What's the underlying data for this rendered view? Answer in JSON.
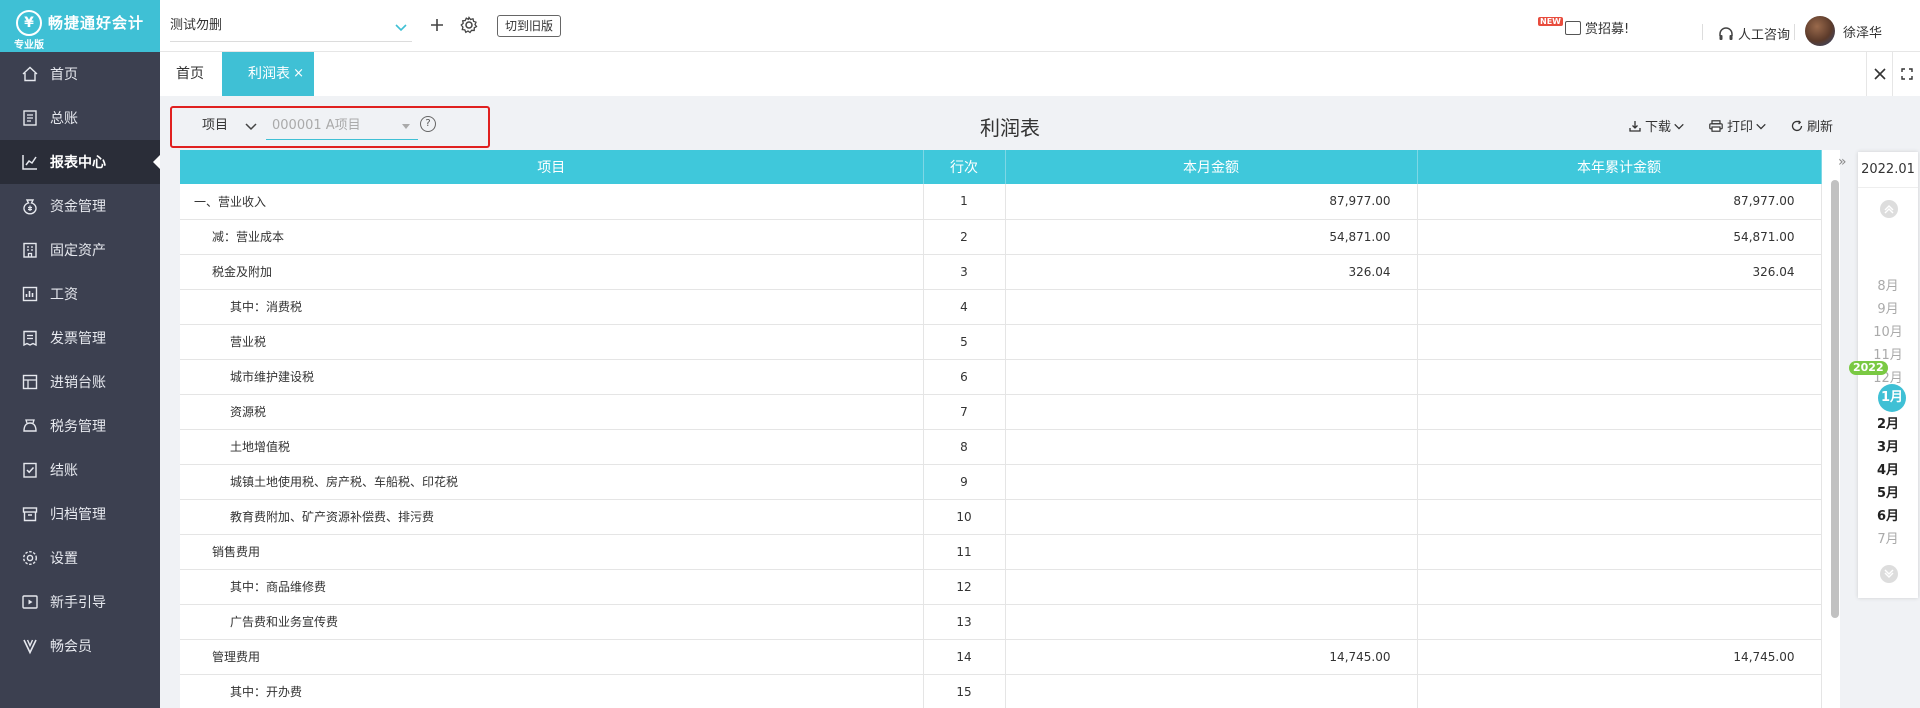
{
  "app": {
    "brand": "畅捷通好会计",
    "edition": "专业版"
  },
  "sidebar": {
    "items": [
      {
        "label": "首页",
        "icon": "home-icon"
      },
      {
        "label": "总账",
        "icon": "ledger-icon"
      },
      {
        "label": "报表中心",
        "icon": "chart-icon",
        "active": true
      },
      {
        "label": "资金管理",
        "icon": "money-bag-icon"
      },
      {
        "label": "固定资产",
        "icon": "building-icon"
      },
      {
        "label": "工资",
        "icon": "salary-icon"
      },
      {
        "label": "发票管理",
        "icon": "invoice-icon"
      },
      {
        "label": "进销台账",
        "icon": "inventory-icon"
      },
      {
        "label": "税务管理",
        "icon": "tax-icon"
      },
      {
        "label": "结账",
        "icon": "closing-icon"
      },
      {
        "label": "归档管理",
        "icon": "archive-icon"
      },
      {
        "label": "设置",
        "icon": "gear-icon"
      },
      {
        "label": "新手引导",
        "icon": "guide-icon"
      },
      {
        "label": "畅会员",
        "icon": "vip-icon"
      }
    ]
  },
  "topbar": {
    "account": "测试勿删",
    "switch_old": "切到旧版",
    "promo": "赏招募!",
    "promo_badge": "NEW",
    "support": "人工咨询",
    "user": "徐泽华"
  },
  "tabs": {
    "home": "首页",
    "profit": "利润表",
    "close": "×"
  },
  "toolbar": {
    "dimension": "项目",
    "item_placeholder": "000001 A项目",
    "help": "?",
    "title": "利润表",
    "download": "下载",
    "print": "打印",
    "refresh": "刷新"
  },
  "table": {
    "headers": [
      "项目",
      "行次",
      "本月金额",
      "本年累计金额"
    ],
    "rows": [
      {
        "item": "一、营业收入",
        "line": "1",
        "month": "87,977.00",
        "year": "87,977.00",
        "indent": 0
      },
      {
        "item": "减：营业成本",
        "line": "2",
        "month": "54,871.00",
        "year": "54,871.00",
        "indent": 1
      },
      {
        "item": "税金及附加",
        "line": "3",
        "month": "326.04",
        "year": "326.04",
        "indent": 1
      },
      {
        "item": "其中：消费税",
        "line": "4",
        "month": "",
        "year": "",
        "indent": 2
      },
      {
        "item": "营业税",
        "line": "5",
        "month": "",
        "year": "",
        "indent": 2
      },
      {
        "item": "城市维护建设税",
        "line": "6",
        "month": "",
        "year": "",
        "indent": 2
      },
      {
        "item": "资源税",
        "line": "7",
        "month": "",
        "year": "",
        "indent": 2
      },
      {
        "item": "土地增值税",
        "line": "8",
        "month": "",
        "year": "",
        "indent": 2
      },
      {
        "item": "城镇土地使用税、房产税、车船税、印花税",
        "line": "9",
        "month": "",
        "year": "",
        "indent": 2
      },
      {
        "item": "教育费附加、矿产资源补偿费、排污费",
        "line": "10",
        "month": "",
        "year": "",
        "indent": 2
      },
      {
        "item": "销售费用",
        "line": "11",
        "month": "",
        "year": "",
        "indent": 1
      },
      {
        "item": "其中：商品维修费",
        "line": "12",
        "month": "",
        "year": "",
        "indent": 2
      },
      {
        "item": "广告费和业务宣传费",
        "line": "13",
        "month": "",
        "year": "",
        "indent": 2
      },
      {
        "item": "管理费用",
        "line": "14",
        "month": "14,745.00",
        "year": "14,745.00",
        "indent": 1
      },
      {
        "item": "其中：开办费",
        "line": "15",
        "month": "",
        "year": "",
        "indent": 2
      }
    ]
  },
  "period": {
    "current": "2022.01",
    "year_badge": "2022",
    "months": [
      {
        "label": "8月",
        "style": "gray"
      },
      {
        "label": "9月",
        "style": "gray"
      },
      {
        "label": "10月",
        "style": "gray"
      },
      {
        "label": "11月",
        "style": "gray"
      },
      {
        "label": "12月",
        "style": "gray"
      },
      {
        "label": "1月",
        "style": "active"
      },
      {
        "label": "2月",
        "style": "dark"
      },
      {
        "label": "3月",
        "style": "dark"
      },
      {
        "label": "4月",
        "style": "dark"
      },
      {
        "label": "5月",
        "style": "dark"
      },
      {
        "label": "6月",
        "style": "dark"
      },
      {
        "label": "7月",
        "style": "gray"
      }
    ]
  },
  "colors": {
    "accent": "#3fc0d5",
    "sidebar": "#3c4050",
    "highlight_box": "#e02020"
  }
}
